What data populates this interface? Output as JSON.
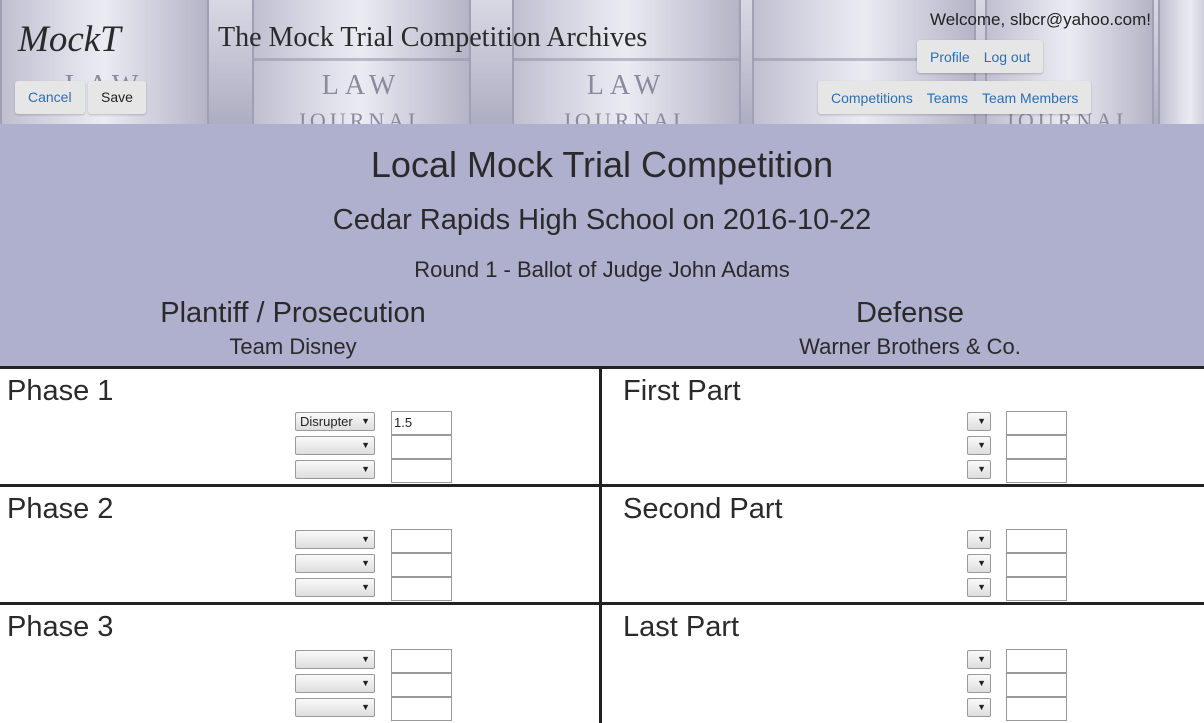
{
  "header": {
    "logo": "MockT",
    "site_title": "The Mock Trial Competition Archives",
    "welcome": "Welcome, slbcr@yahoo.com!",
    "cancel_label": "Cancel",
    "save_label": "Save",
    "user_menu": [
      "Profile",
      "Log out"
    ],
    "nav_menu": [
      "Competitions",
      "Teams",
      "Team Members"
    ],
    "background_spine_text": [
      "LAW",
      "JOURNAL"
    ]
  },
  "banner": {
    "competition": "Local Mock Trial Competition",
    "school_date": "Cedar Rapids High School on 2016-10-22",
    "round": "Round 1 - Ballot of Judge John Adams",
    "plaintiff_role": "Plantiff / Prosecution",
    "plaintiff_team": "Team Disney",
    "defense_role": "Defense",
    "defense_team": "Warner Brothers & Co."
  },
  "ballot": {
    "plaintiff_phases": [
      {
        "label": "Phase 1",
        "rows": [
          {
            "select": "Disrupter",
            "score": "1.5"
          },
          {
            "select": "",
            "score": ""
          },
          {
            "select": "",
            "score": ""
          }
        ]
      },
      {
        "label": "Phase 2",
        "rows": [
          {
            "select": "",
            "score": ""
          },
          {
            "select": "",
            "score": ""
          },
          {
            "select": "",
            "score": ""
          }
        ]
      },
      {
        "label": "Phase 3",
        "rows": [
          {
            "select": "",
            "score": ""
          },
          {
            "select": "",
            "score": ""
          },
          {
            "select": "",
            "score": ""
          }
        ]
      }
    ],
    "defense_parts": [
      {
        "label": "First Part",
        "rows": [
          {
            "select": "",
            "score": ""
          },
          {
            "select": "",
            "score": ""
          },
          {
            "select": "",
            "score": ""
          }
        ]
      },
      {
        "label": "Second Part",
        "rows": [
          {
            "select": "",
            "score": ""
          },
          {
            "select": "",
            "score": ""
          },
          {
            "select": "",
            "score": ""
          }
        ]
      },
      {
        "label": "Last Part",
        "rows": [
          {
            "select": "",
            "score": ""
          },
          {
            "select": "",
            "score": ""
          },
          {
            "select": "",
            "score": ""
          }
        ]
      }
    ]
  },
  "icons": {
    "dropdown": "chevron-down-icon"
  },
  "colors": {
    "banner": "#afafce",
    "link": "#2d6fb0",
    "divider": "#222222"
  }
}
